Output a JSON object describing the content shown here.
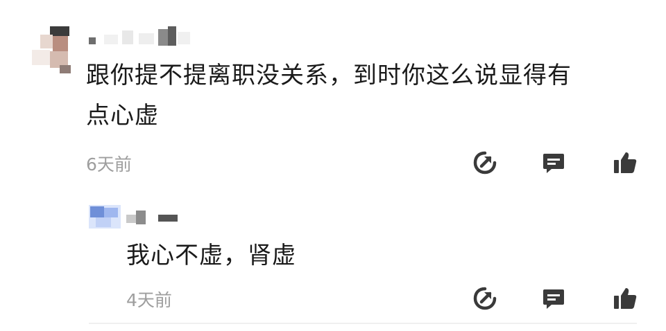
{
  "comment": {
    "text_line1": "跟你提不提离职没关系，到时你这么说显得有",
    "text_line2": "点心虚",
    "time": "6天前"
  },
  "reply": {
    "text": "我心不虚，肾虚",
    "time": "4天前"
  },
  "icons": {
    "share": "share-icon",
    "reply": "comment-icon",
    "like": "thumbs-up-icon"
  },
  "colors": {
    "text": "#1a1a1a",
    "meta": "#9e9e9e",
    "icon": "#3a3a3a",
    "reply_avatar": "#6f8fd8"
  }
}
